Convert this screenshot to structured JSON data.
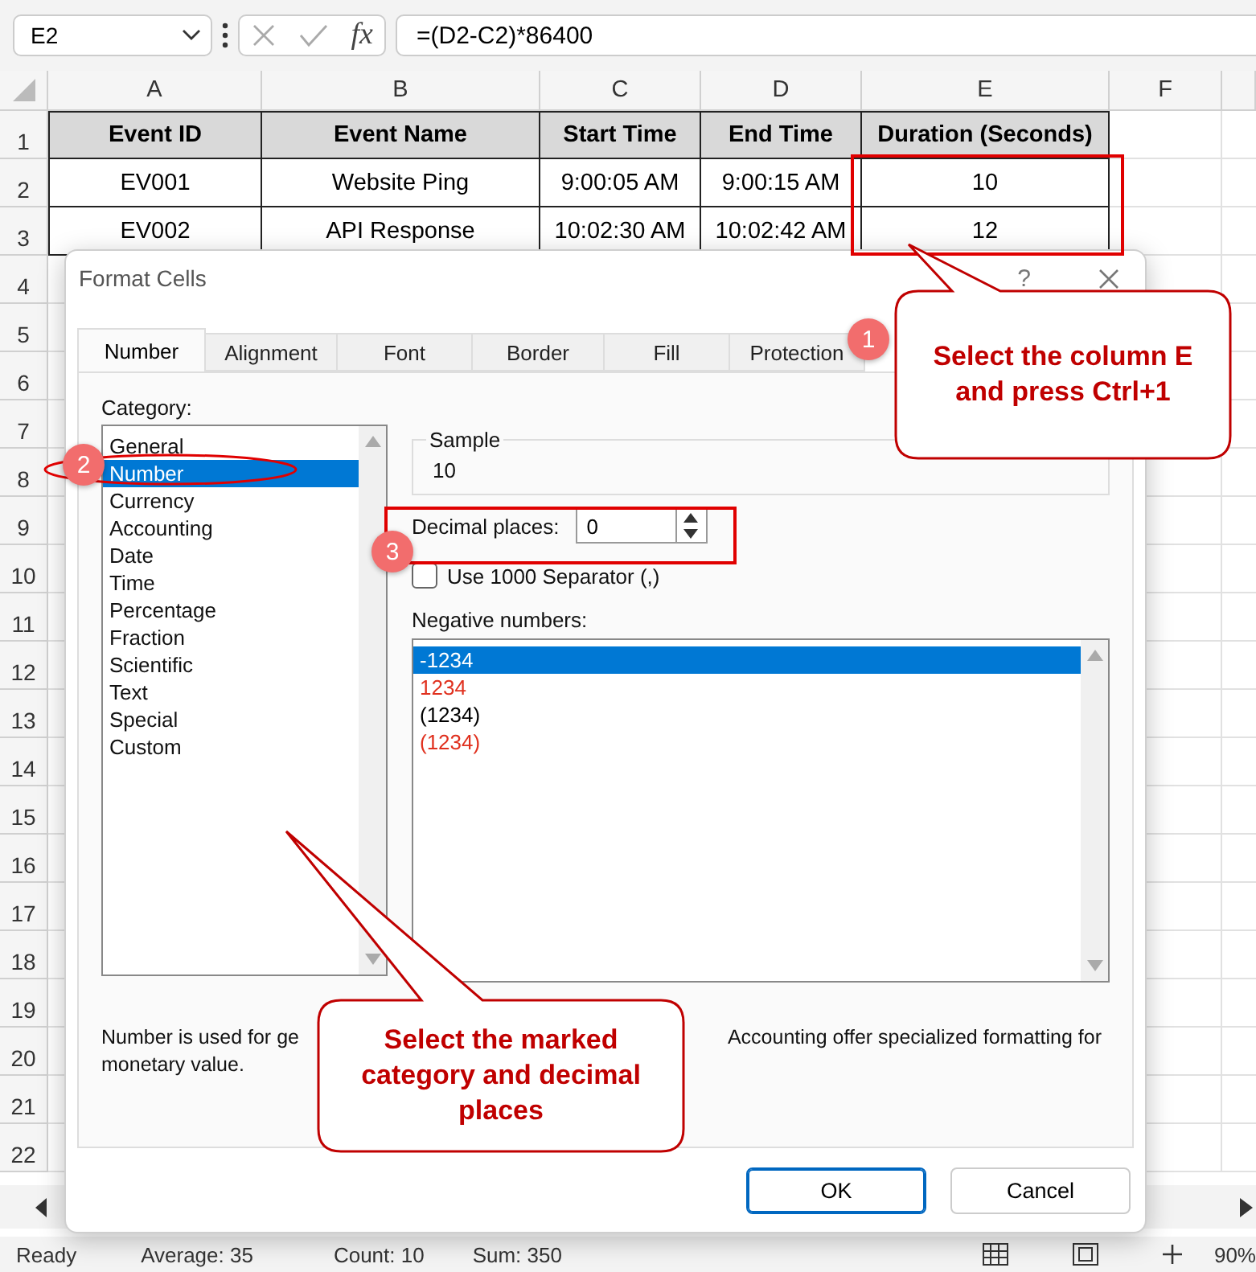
{
  "name_box": {
    "value": "E2"
  },
  "function_label": "fx",
  "formula": {
    "value": "=(D2-C2)*86400"
  },
  "columns": [
    "A",
    "B",
    "C",
    "D",
    "E",
    "F"
  ],
  "row_numbers": [
    "1",
    "2",
    "3",
    "4",
    "5",
    "6",
    "7",
    "8",
    "9",
    "10",
    "11",
    "12",
    "13",
    "14",
    "15",
    "16",
    "17",
    "18",
    "19",
    "20",
    "21",
    "22"
  ],
  "table": {
    "columns": [
      "Event ID",
      "Event Name",
      "Start Time",
      "End Time",
      "Duration (Seconds)"
    ],
    "rows": [
      [
        "EV001",
        "Website Ping",
        "9:00:05 AM",
        "9:00:15 AM",
        "10"
      ],
      [
        "EV002",
        "API Response",
        "10:02:30 AM",
        "10:02:42 AM",
        "12"
      ]
    ]
  },
  "dialog": {
    "title": "Format Cells",
    "help": "?",
    "tabs": [
      {
        "label": "Number",
        "selected": true
      },
      {
        "label": "Alignment",
        "selected": false
      },
      {
        "label": "Font",
        "selected": false
      },
      {
        "label": "Border",
        "selected": false
      },
      {
        "label": "Fill",
        "selected": false
      },
      {
        "label": "Protection",
        "selected": false
      }
    ],
    "category_label": "Category:",
    "categories": [
      {
        "label": "General",
        "selected": false
      },
      {
        "label": "Number",
        "selected": true
      },
      {
        "label": "Currency",
        "selected": false
      },
      {
        "label": "Accounting",
        "selected": false
      },
      {
        "label": "Date",
        "selected": false
      },
      {
        "label": "Time",
        "selected": false
      },
      {
        "label": "Percentage",
        "selected": false
      },
      {
        "label": "Fraction",
        "selected": false
      },
      {
        "label": "Scientific",
        "selected": false
      },
      {
        "label": "Text",
        "selected": false
      },
      {
        "label": "Special",
        "selected": false
      },
      {
        "label": "Custom",
        "selected": false
      }
    ],
    "sample_label": "Sample",
    "sample_value": "10",
    "decimal_label": "Decimal places:",
    "decimal_value": "0",
    "separator": {
      "label": "Use 1000 Separator (,)",
      "checked": false
    },
    "negative_label": "Negative numbers:",
    "negative_formats": [
      {
        "label": "-1234",
        "selected": true
      },
      {
        "label": "1234",
        "color": "#e0301e",
        "selected": false
      },
      {
        "label": "(1234)",
        "color": "#000000",
        "selected": false
      },
      {
        "label": "(1234)",
        "color": "#e0301e",
        "selected": false
      }
    ],
    "description_parts": [
      "Number is used for ge",
      "Accounting offer specialized formatting for",
      "monetary value."
    ],
    "buttons": [
      {
        "label": "OK",
        "kind": "primary"
      },
      {
        "label": "Cancel",
        "kind": "secondary"
      }
    ]
  },
  "annotations": {
    "badges": [
      "1",
      "2",
      "3"
    ],
    "callouts": [
      "Select the column E and press Ctrl+1",
      "Select the marked category and decimal places"
    ]
  },
  "status_bar": {
    "ready": "Ready",
    "average": "Average: 35",
    "count": "Count: 10",
    "sum": "Sum: 350",
    "zoom": "90%"
  }
}
